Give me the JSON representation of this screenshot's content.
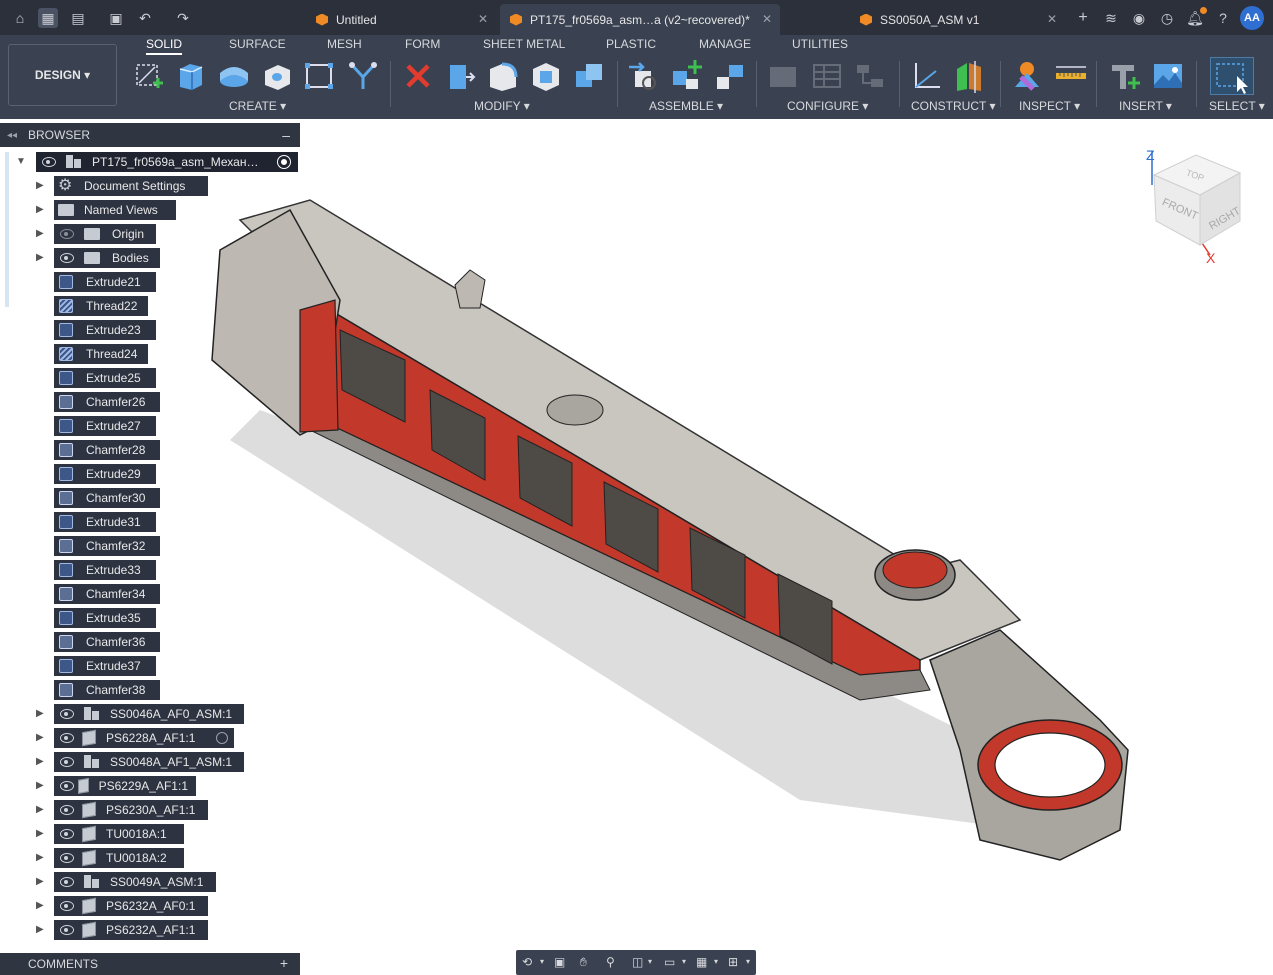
{
  "tabs": [
    {
      "label": "Untitled"
    },
    {
      "label": "PT175_fr0569a_asm…a (v2~recovered)*"
    },
    {
      "label": "SS0050A_ASM v1"
    }
  ],
  "user": {
    "initials": "AA"
  },
  "workspace": {
    "label": "DESIGN"
  },
  "toolbar_tabs": [
    "SOLID",
    "SURFACE",
    "MESH",
    "FORM",
    "SHEET METAL",
    "PLASTIC",
    "MANAGE",
    "UTILITIES"
  ],
  "tool_groups": [
    "CREATE",
    "MODIFY",
    "ASSEMBLE",
    "CONFIGURE",
    "CONSTRUCT",
    "INSPECT",
    "INSERT",
    "SELECT"
  ],
  "browser": {
    "title": "BROWSER",
    "root": "PT175_fr0569a_asm_Механ…",
    "folders": [
      "Document Settings",
      "Named Views",
      "Origin",
      "Bodies"
    ],
    "features": [
      {
        "label": "Extrude21",
        "kind": "extrude"
      },
      {
        "label": "Thread22",
        "kind": "thread"
      },
      {
        "label": "Extrude23",
        "kind": "extrude"
      },
      {
        "label": "Thread24",
        "kind": "thread"
      },
      {
        "label": "Extrude25",
        "kind": "extrude"
      },
      {
        "label": "Chamfer26",
        "kind": "chamfer"
      },
      {
        "label": "Extrude27",
        "kind": "extrude"
      },
      {
        "label": "Chamfer28",
        "kind": "chamfer"
      },
      {
        "label": "Extrude29",
        "kind": "extrude"
      },
      {
        "label": "Chamfer30",
        "kind": "chamfer"
      },
      {
        "label": "Extrude31",
        "kind": "extrude"
      },
      {
        "label": "Chamfer32",
        "kind": "chamfer"
      },
      {
        "label": "Extrude33",
        "kind": "extrude"
      },
      {
        "label": "Chamfer34",
        "kind": "chamfer"
      },
      {
        "label": "Extrude35",
        "kind": "extrude"
      },
      {
        "label": "Chamfer36",
        "kind": "chamfer"
      },
      {
        "label": "Extrude37",
        "kind": "extrude"
      },
      {
        "label": "Chamfer38",
        "kind": "chamfer"
      }
    ],
    "components": [
      {
        "label": "SS0046A_AF0_ASM:1",
        "kind": "asm"
      },
      {
        "label": "PS6228A_AF1:1",
        "kind": "body"
      },
      {
        "label": "SS0048A_AF1_ASM:1",
        "kind": "asm"
      },
      {
        "label": "PS6229A_AF1:1",
        "kind": "body"
      },
      {
        "label": "PS6230A_AF1:1",
        "kind": "body"
      },
      {
        "label": "TU0018A:1",
        "kind": "body"
      },
      {
        "label": "TU0018A:2",
        "kind": "body"
      },
      {
        "label": "SS0049A_ASM:1",
        "kind": "asm"
      },
      {
        "label": "PS6232A_AF0:1",
        "kind": "body"
      },
      {
        "label": "PS6232A_AF1:1",
        "kind": "body"
      }
    ]
  },
  "comments": {
    "title": "COMMENTS"
  },
  "viewcube": {
    "top": "TOP",
    "front": "FRONT",
    "right": "RIGHT",
    "axis_x": "X",
    "axis_z": "Z"
  },
  "colors": {
    "accent_red": "#c2392c",
    "model_gray": "#bdb9b2",
    "ui_dark": "#3a4150"
  }
}
